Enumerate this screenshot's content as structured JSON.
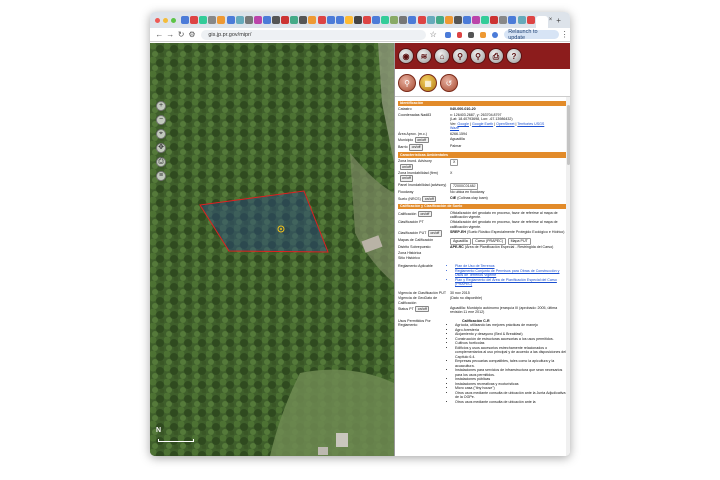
{
  "browser": {
    "url": "gis.jp.pr.gov/mipr/",
    "relaunch_label": "Relaunch to update",
    "new_tab": "+",
    "close_tab": "×"
  },
  "map": {
    "north_label": "N"
  },
  "info": {
    "sec_ident": "Identificación",
    "catastro_label": "Catastro",
    "catastro_value": "040-000-010-20",
    "coords_label": "Coordenadas Nad83",
    "coords_line1": "x: 126403.2687, y: 263704.8797",
    "coords_line2": "(Lat: 18.40793698, Lon: -67.13986432)",
    "coords_ver": "Ver:",
    "link_google": "Google",
    "link_earth": "Google Earth",
    "link_osm": "OpenStreet",
    "link_usgs": "Territories USGS",
    "link_waze": "Waze",
    "area_label": "Área Aprox. (m.c.)",
    "area_value": "6266.1594",
    "municipio_label": "Municipio",
    "municipio_value": "Aguadilla",
    "barrio_label": "Barrio",
    "barrio_value": "Palmar",
    "onoff": "on/off",
    "sec_caract": "Características Ambientales",
    "tsunami_label": "Zona Inund. Advisory",
    "tsunami_value": "X",
    "zona_inund_label": "Zona Inundabilidad (firm)",
    "zona_inund_value": "X",
    "panel_label": "Panel Inundabilidad (advisory)",
    "panel_value": "72000C0148J",
    "floodway_label": "Floodway",
    "floodway_value": "No ubica en floodway",
    "suelo_label": "Suelo (NRCS)",
    "suelo_value_b": "CtE",
    "suelo_value": "(Colinas clay loam)",
    "sec_calif": "Calificación y Clasificación de Suelo",
    "calif_label": "Calificación",
    "calif_value": "Oficialización del geodato en proceso, favor de referirse al mapa de calificación vigente.",
    "clasif_pt_label": "Clasificación PT",
    "clasif_pt_value": "Oficialización del geodato en proceso, favor de referirse al mapa de calificación vigente.",
    "clasif_put_label": "Clasificación PUT",
    "clasif_put_b": "SREP-EH",
    "clasif_put_value": "(Suelo Rústico Especialmente Protegido Ecológico e Hídrico)",
    "mapas_label": "Mapas de Calificación",
    "mapas_1": "Aguadilla",
    "mapas_2": "Carso (PRAPEC)",
    "mapas_3": "Mapa PUT",
    "distrito_label": "Distrito Sobrepuesto",
    "distrito_b": "APE-RC",
    "distrito_value": "(Área de Planificación Especial - Restringida del Carso)",
    "zona_hist_label": "Zona Histórica",
    "sitio_hist_label": "Sitio Histórico",
    "regl_label": "Reglamento Aplicable",
    "regl_1": "Plan de Uso de Terrenos",
    "regl_2": "Reglamento Conjunto de Permisos para Obras de Construcción y Usos de Terrenos Vigente",
    "regl_3": "Plan y Reglamento del Área de Planificación Especial del Carso (PRAPEC)",
    "vig_clasif_label": "Vigencia de Clasificación PUT",
    "vig_clasif_value": "30 nov 2015",
    "vig_geo_label": "Vigencia de GeoDato de Calificación",
    "vig_geo_value": "(Dato no disponible)",
    "status_label": "Status PT",
    "status_value": "Aguadilla: Municipio autónomo jerarquía III (aprobado: 2005, última revisión:11 ene 2012)",
    "usos_label": "Usos Permitidos Por Reglamento",
    "usos_title": "Calificación C-R",
    "usos": [
      "Agrícola, utilizando las mejores prácticas de manejo",
      "Agro-forestería",
      "Alojamiento y desayuno (Bed & Breakfast)",
      "Construcción de estructuras accesorias a los usos permitidos.",
      "Cultivos hortícolas",
      "Edificios y usos accesorios estrechamente relacionados o complementarios al uso principal y de acuerdo a las disposiciones del Capítulo 6.4.",
      "Empresas pecuarias compatibles, tales como la apicultura y la acuacultura.",
      "Instalaciones para servicios de infraestructura que sean necesarios para los usos permitidos.",
      "Instalaciones públicas",
      "Instalaciones recreativas y ecoturísticas",
      "Micro casa (\"tiny house\")",
      "Otros usos mediante consulta de ubicación ante la Junta Adjudicativa de la OGPe.",
      "Otros usos mediante consulta de ubicación ante la"
    ]
  }
}
